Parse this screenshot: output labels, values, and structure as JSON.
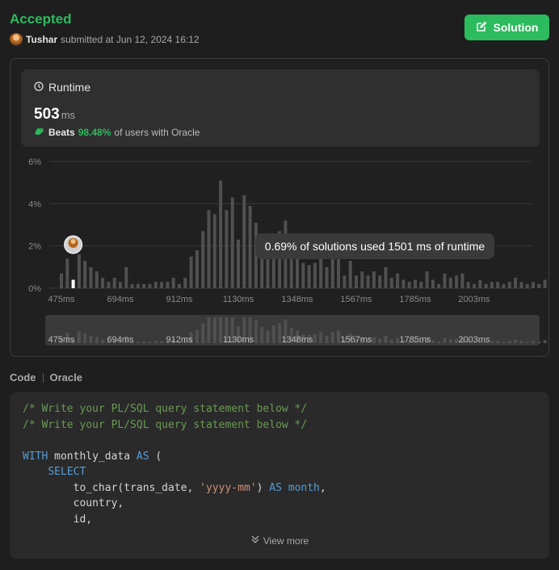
{
  "submission": {
    "status": "Accepted",
    "user": "Tushar",
    "submitted_text": "submitted at Jun 12, 2024 16:12",
    "solution_label": "Solution"
  },
  "runtime": {
    "title": "Runtime",
    "value": "503",
    "unit": "ms",
    "beats_label": "Beats",
    "beats_pct": "98.48%",
    "beats_suffix": "of users with Oracle"
  },
  "tooltip": "0.69% of solutions used 1501 ms of runtime",
  "chart_data": {
    "type": "bar",
    "ylabel": "",
    "xlabel": "",
    "y_ticks": [
      "6%",
      "4%",
      "2%",
      "0%"
    ],
    "ylim": [
      0,
      6
    ],
    "x_ticks": [
      "475ms",
      "694ms",
      "912ms",
      "1130ms",
      "1348ms",
      "1567ms",
      "1785ms",
      "2003ms"
    ],
    "grid": true,
    "highlight_index": 2,
    "values": [
      0.7,
      1.4,
      0.4,
      1.6,
      1.3,
      1.0,
      0.8,
      0.5,
      0.3,
      0.5,
      0.3,
      1.0,
      0.2,
      0.2,
      0.2,
      0.2,
      0.3,
      0.3,
      0.3,
      0.5,
      0.2,
      0.5,
      1.5,
      1.8,
      2.7,
      3.7,
      3.5,
      5.1,
      3.7,
      4.3,
      2.3,
      4.4,
      3.9,
      3.1,
      2.2,
      1.7,
      2.4,
      2.7,
      3.2,
      2.1,
      1.7,
      1.2,
      1.1,
      1.2,
      1.5,
      1.0,
      1.5,
      1.7,
      0.6,
      1.3,
      0.6,
      0.8,
      0.6,
      0.8,
      0.6,
      1.0,
      0.5,
      0.7,
      0.4,
      0.3,
      0.4,
      0.3,
      0.8,
      0.4,
      0.2,
      0.7,
      0.5,
      0.6,
      0.7,
      0.3,
      0.2,
      0.4,
      0.2,
      0.3,
      0.3,
      0.2,
      0.3,
      0.5,
      0.3,
      0.2,
      0.3,
      0.2,
      0.4,
      0.2,
      0.3,
      0.2,
      0.2
    ]
  },
  "code": {
    "tab_label": "Code",
    "language": "Oracle",
    "view_more": "View more",
    "lines": [
      [
        {
          "t": "/* Write your PL/SQL query statement below */",
          "c": "comment"
        }
      ],
      [
        {
          "t": "/* Write your PL/SQL query statement below */",
          "c": "comment"
        }
      ],
      [],
      [
        {
          "t": "WITH",
          "c": "kw"
        },
        {
          "t": " monthly_data ",
          "c": ""
        },
        {
          "t": "AS",
          "c": "kw"
        },
        {
          "t": " (",
          "c": ""
        }
      ],
      [
        {
          "t": "    ",
          "c": ""
        },
        {
          "t": "SELECT",
          "c": "kw"
        }
      ],
      [
        {
          "t": "        to_char(trans_date, ",
          "c": ""
        },
        {
          "t": "'yyyy-mm'",
          "c": "str"
        },
        {
          "t": ") ",
          "c": ""
        },
        {
          "t": "AS",
          "c": "kw"
        },
        {
          "t": " ",
          "c": ""
        },
        {
          "t": "month",
          "c": "kw"
        },
        {
          "t": ",",
          "c": ""
        }
      ],
      [
        {
          "t": "        country,",
          "c": ""
        }
      ],
      [
        {
          "t": "        id,",
          "c": ""
        }
      ]
    ]
  }
}
